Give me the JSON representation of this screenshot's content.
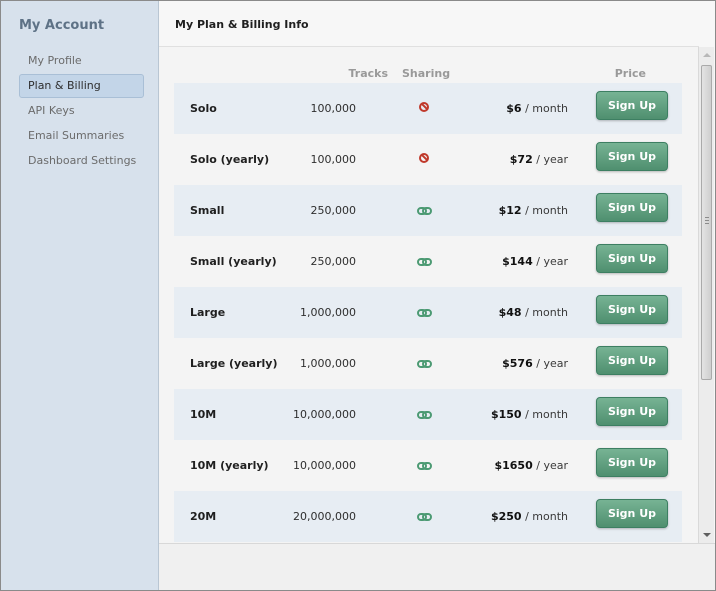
{
  "sidebar": {
    "title": "My Account",
    "items": [
      {
        "label": "My Profile"
      },
      {
        "label": "Plan & Billing"
      },
      {
        "label": "API Keys"
      },
      {
        "label": "Email Summaries"
      },
      {
        "label": "Dashboard Settings"
      }
    ]
  },
  "main": {
    "title": "My Plan & Billing Info",
    "table": {
      "headers": {
        "tracks": "Tracks",
        "sharing": "Sharing",
        "price": "Price"
      },
      "rows": [
        {
          "plan": "Solo",
          "tracks": "100,000",
          "sharing_icon": "no-sharing-icon",
          "price_amount": "$6",
          "price_period": "/ month",
          "button": "Sign Up"
        },
        {
          "plan": "Solo (yearly)",
          "tracks": "100,000",
          "sharing_icon": "no-sharing-icon",
          "price_amount": "$72",
          "price_period": "/ year",
          "button": "Sign Up"
        },
        {
          "plan": "Small",
          "tracks": "250,000",
          "sharing_icon": "sharing-link-icon",
          "price_amount": "$12",
          "price_period": "/ month",
          "button": "Sign Up"
        },
        {
          "plan": "Small (yearly)",
          "tracks": "250,000",
          "sharing_icon": "sharing-link-icon",
          "price_amount": "$144",
          "price_period": "/ year",
          "button": "Sign Up"
        },
        {
          "plan": "Large",
          "tracks": "1,000,000",
          "sharing_icon": "sharing-link-icon",
          "price_amount": "$48",
          "price_period": "/ month",
          "button": "Sign Up"
        },
        {
          "plan": "Large (yearly)",
          "tracks": "1,000,000",
          "sharing_icon": "sharing-link-icon",
          "price_amount": "$576",
          "price_period": "/ year",
          "button": "Sign Up"
        },
        {
          "plan": "10M",
          "tracks": "10,000,000",
          "sharing_icon": "sharing-link-icon",
          "price_amount": "$150",
          "price_period": "/ month",
          "button": "Sign Up"
        },
        {
          "plan": "10M (yearly)",
          "tracks": "10,000,000",
          "sharing_icon": "sharing-link-icon",
          "price_amount": "$1650",
          "price_period": "/ year",
          "button": "Sign Up"
        },
        {
          "plan": "20M",
          "tracks": "20,000,000",
          "sharing_icon": "sharing-link-icon",
          "price_amount": "$250",
          "price_period": "/ month",
          "button": "Sign Up"
        }
      ]
    }
  },
  "colors": {
    "sidebar_bg": "#d7e1ec",
    "active_nav_bg": "#c3d5e8",
    "row_alt_bg": "#e7edf3",
    "signup_button": "#5f9f7f",
    "no_sharing_icon": "#c0392b",
    "sharing_icon": "#4c9a73"
  }
}
